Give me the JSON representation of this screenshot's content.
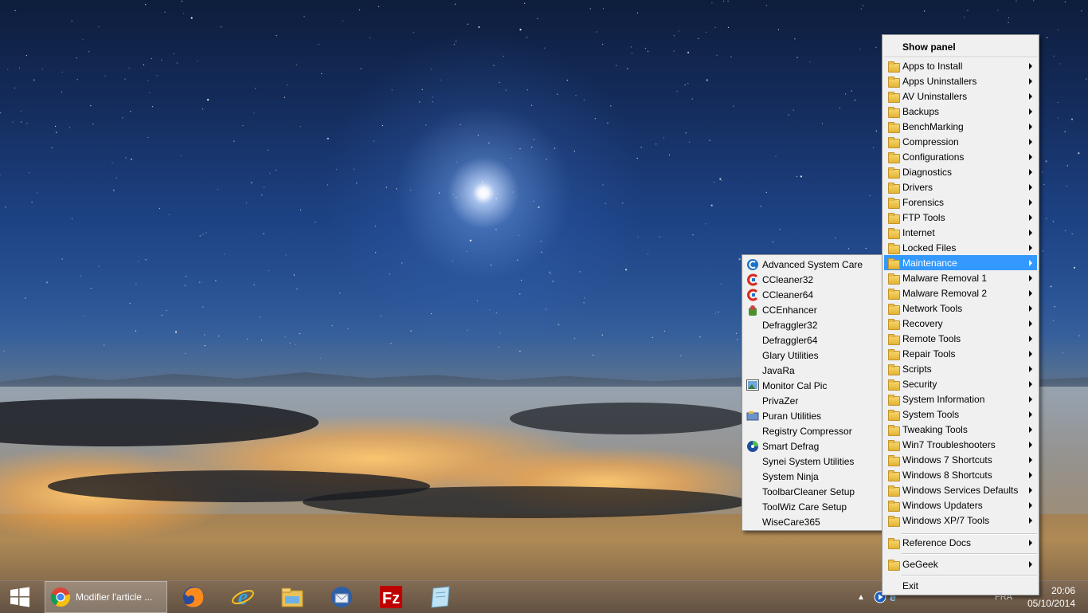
{
  "desktop": {
    "wallpaper": "night sky with moon over foggy city lights"
  },
  "taskbar": {
    "active_window_title": "Modifier l'article ...",
    "apps": [
      "chrome-icon",
      "firefox-icon",
      "internet-explorer-icon",
      "file-explorer-icon",
      "thunderbird-icon",
      "filezilla-icon",
      "notepad-icon"
    ],
    "language": "FRA",
    "time": "20:06",
    "date": "05/10/2014"
  },
  "main_menu": {
    "header": "Show panel",
    "items": [
      "Apps to Install",
      "Apps Uninstallers",
      "AV Uninstallers",
      "Backups",
      "BenchMarking",
      "Compression",
      "Configurations",
      "Diagnostics",
      "Drivers",
      "Forensics",
      "FTP Tools",
      "Internet",
      "Locked Files",
      "Maintenance",
      "Malware Removal 1",
      "Malware Removal 2",
      "Network Tools",
      "Recovery",
      "Remote Tools",
      "Repair Tools",
      "Scripts",
      "Security",
      "System Information",
      "System Tools",
      "Tweaking Tools",
      "Win7 Troubleshooters",
      "Windows 7 Shortcuts",
      "Windows 8 Shortcuts",
      "Windows Services Defaults",
      "Windows Updaters",
      "Windows XP/7 Tools"
    ],
    "highlighted": "Maintenance",
    "reference": "Reference Docs",
    "gegeek": "GeGeek",
    "exit": "Exit"
  },
  "sub_menu": {
    "items": [
      {
        "label": "Advanced System Care",
        "icon": "advanced-systemcare-icon"
      },
      {
        "label": "CCleaner32",
        "icon": "ccleaner-icon"
      },
      {
        "label": "CCleaner64",
        "icon": "ccleaner-icon"
      },
      {
        "label": "CCEnhancer",
        "icon": "ccenhancer-icon"
      },
      {
        "label": "Defraggler32",
        "icon": ""
      },
      {
        "label": "Defraggler64",
        "icon": ""
      },
      {
        "label": "Glary Utilities",
        "icon": ""
      },
      {
        "label": "JavaRa",
        "icon": ""
      },
      {
        "label": "Monitor Cal Pic",
        "icon": "picture-icon"
      },
      {
        "label": "PrivaZer",
        "icon": ""
      },
      {
        "label": "Puran Utilities",
        "icon": "puran-icon"
      },
      {
        "label": "Registry Compressor",
        "icon": ""
      },
      {
        "label": "Smart Defrag",
        "icon": "smart-defrag-icon"
      },
      {
        "label": "Synei System Utilities",
        "icon": ""
      },
      {
        "label": "System Ninja",
        "icon": ""
      },
      {
        "label": "ToolbarCleaner Setup",
        "icon": ""
      },
      {
        "label": "ToolWiz Care Setup",
        "icon": ""
      },
      {
        "label": "WiseCare365",
        "icon": ""
      }
    ]
  }
}
